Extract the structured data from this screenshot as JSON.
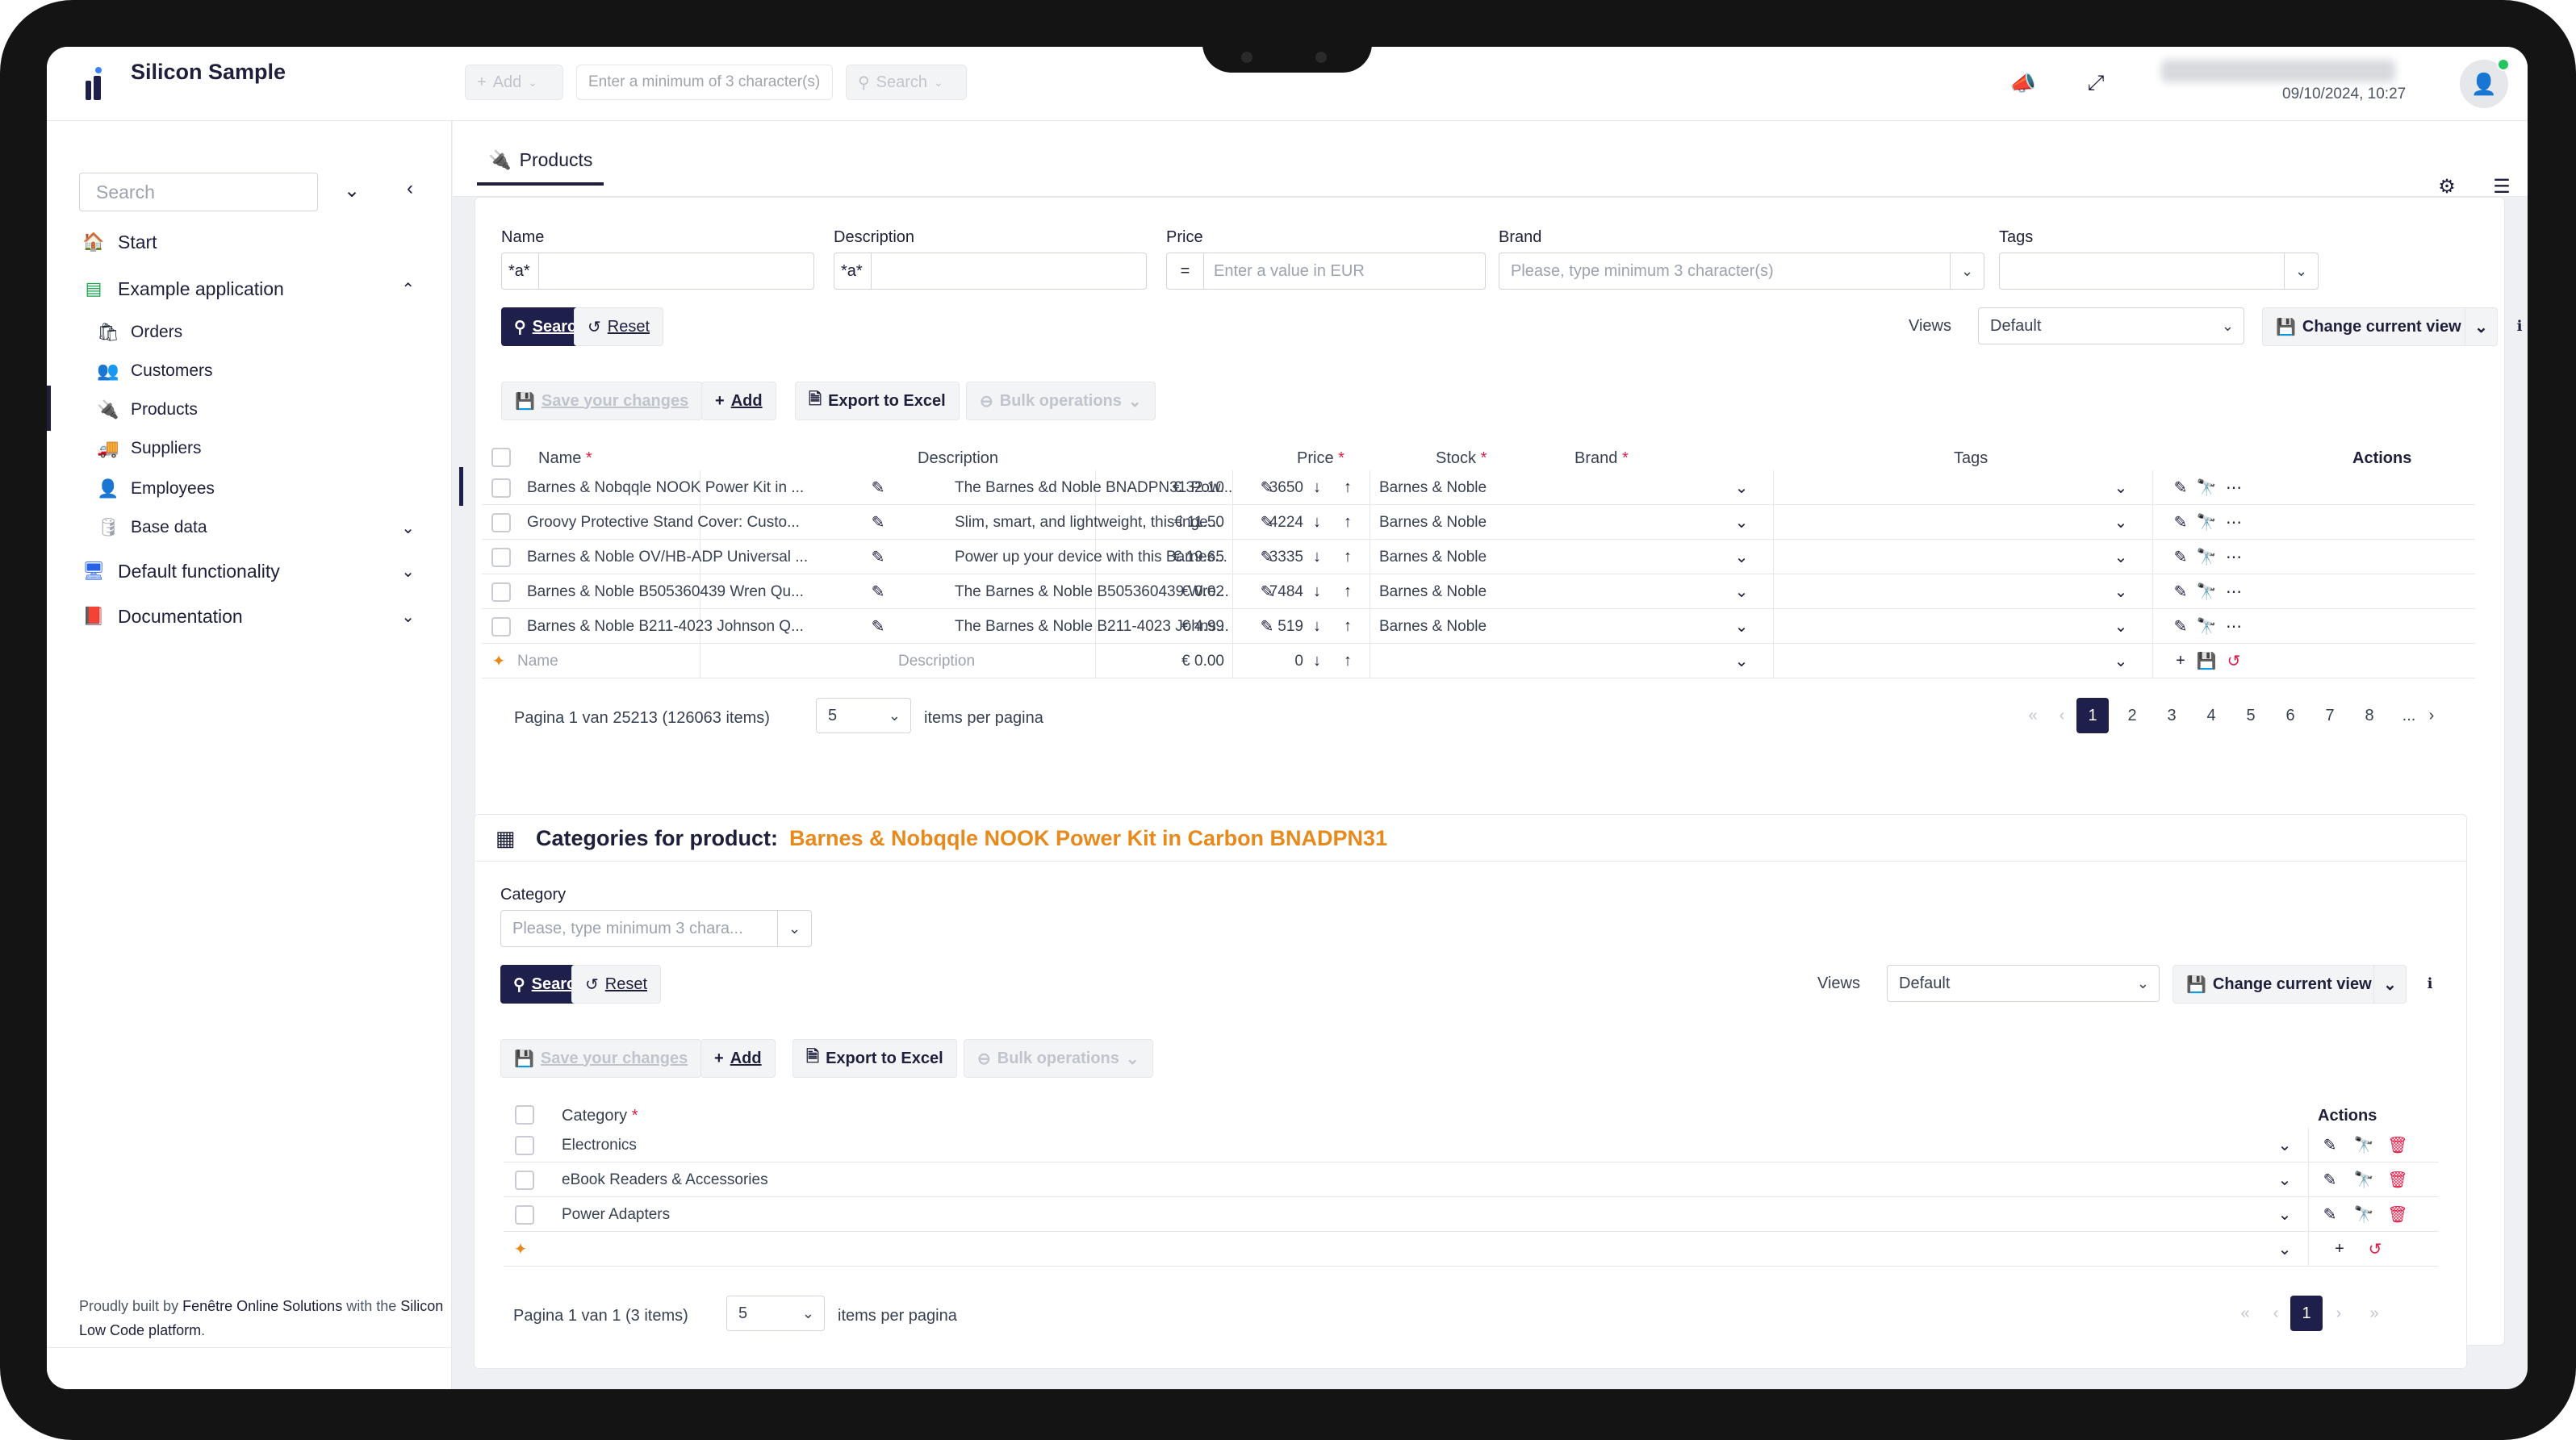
{
  "app": {
    "title": "Silicon Sample",
    "datetime": "09/10/2024, 10:27"
  },
  "topbar": {
    "add_label": "Add",
    "search_placeholder": "Enter a minimum of 3 character(s)",
    "search_label": "Search"
  },
  "sidebar": {
    "search_placeholder": "Search",
    "items": [
      {
        "label": "Start"
      },
      {
        "label": "Example application"
      },
      {
        "label": "Orders"
      },
      {
        "label": "Customers"
      },
      {
        "label": "Products"
      },
      {
        "label": "Suppliers"
      },
      {
        "label": "Employees"
      },
      {
        "label": "Base data"
      },
      {
        "label": "Default functionality"
      },
      {
        "label": "Documentation"
      }
    ],
    "footer": {
      "p1": "Proudly built by ",
      "l1": "Fenêtre Online Solutions",
      "p2": " with the ",
      "l2": "Silicon Low Code platform",
      "p3": "."
    }
  },
  "tab": {
    "label": "Products"
  },
  "filter": {
    "name_label": "Name",
    "name_value": "*a*",
    "desc_label": "Description",
    "desc_value": "*a*",
    "price_label": "Price",
    "price_op": "=",
    "price_placeholder": "Enter a value in EUR",
    "brand_label": "Brand",
    "brand_placeholder": "Please, type minimum 3 character(s)",
    "tags_label": "Tags"
  },
  "actions": {
    "search": "Search",
    "reset": "Reset",
    "views": "Views",
    "view_value": "Default",
    "change_view": "Change current view",
    "save_changes": "Save your changes",
    "add": "Add",
    "export": "Export to Excel",
    "bulk": "Bulk operations"
  },
  "products": {
    "headers": {
      "name": "Name",
      "description": "Description",
      "price": "Price",
      "stock": "Stock",
      "brand": "Brand",
      "tags": "Tags",
      "actions": "Actions"
    },
    "rows": [
      {
        "name": "Barnes & Nobqqle NOOK Power Kit in ...",
        "description": "The Barnes &d Noble BNADPN31 Pow...",
        "price": "€ 32.10",
        "stock": "3650",
        "brand": "Barnes & Noble"
      },
      {
        "name": "Groovy Protective Stand Cover: Custo...",
        "description": "Slim, smart, and lightweight, this inge...",
        "price": "€ 11.50",
        "stock": "4224",
        "brand": "Barnes & Noble"
      },
      {
        "name": "Barnes & Noble OV/HB-ADP Universal ...",
        "description": "Power up your device with this Barnes...",
        "price": "€ 19.65",
        "stock": "3335",
        "brand": "Barnes & Noble"
      },
      {
        "name": "Barnes & Noble B505360439 Wren Qu...",
        "description": "The Barnes & Noble B505360439 Wre...",
        "price": "€ 0.02",
        "stock": "7484",
        "brand": "Barnes & Noble"
      },
      {
        "name": "Barnes & Noble B211-4023 Johnson Q...",
        "description": "The Barnes & Noble B211-4023 Johns...",
        "price": "€ 4.99",
        "stock": "519",
        "brand": "Barnes & Noble"
      }
    ],
    "new_row": {
      "name": "Name",
      "description": "Description",
      "price": "€ 0.00",
      "stock": "0"
    },
    "pager": {
      "info": "Pagina 1 van 25213 (126063 items)",
      "per_page": "5",
      "per_page_label": "items per pagina",
      "pages": [
        "1",
        "2",
        "3",
        "4",
        "5",
        "6",
        "7",
        "8",
        "..."
      ]
    }
  },
  "categories": {
    "title_prefix": "Categories for product:",
    "title_product": "Barnes & Nobqqle NOOK Power Kit in Carbon BNADPN31",
    "filter_label": "Category",
    "filter_placeholder": "Please, type minimum 3 chara...",
    "header": "Category",
    "actions_header": "Actions",
    "rows": [
      "Electronics",
      "eBook Readers & Accessories",
      "Power Adapters"
    ],
    "pager": {
      "info": "Pagina 1 van 1 (3 items)",
      "per_page": "5",
      "per_page_label": "items per pagina",
      "page": "1"
    }
  },
  "colors": {
    "brand": "#1e1f4b",
    "accent": "#e8891c",
    "required": "#e11d48",
    "online": "#22c55e"
  }
}
